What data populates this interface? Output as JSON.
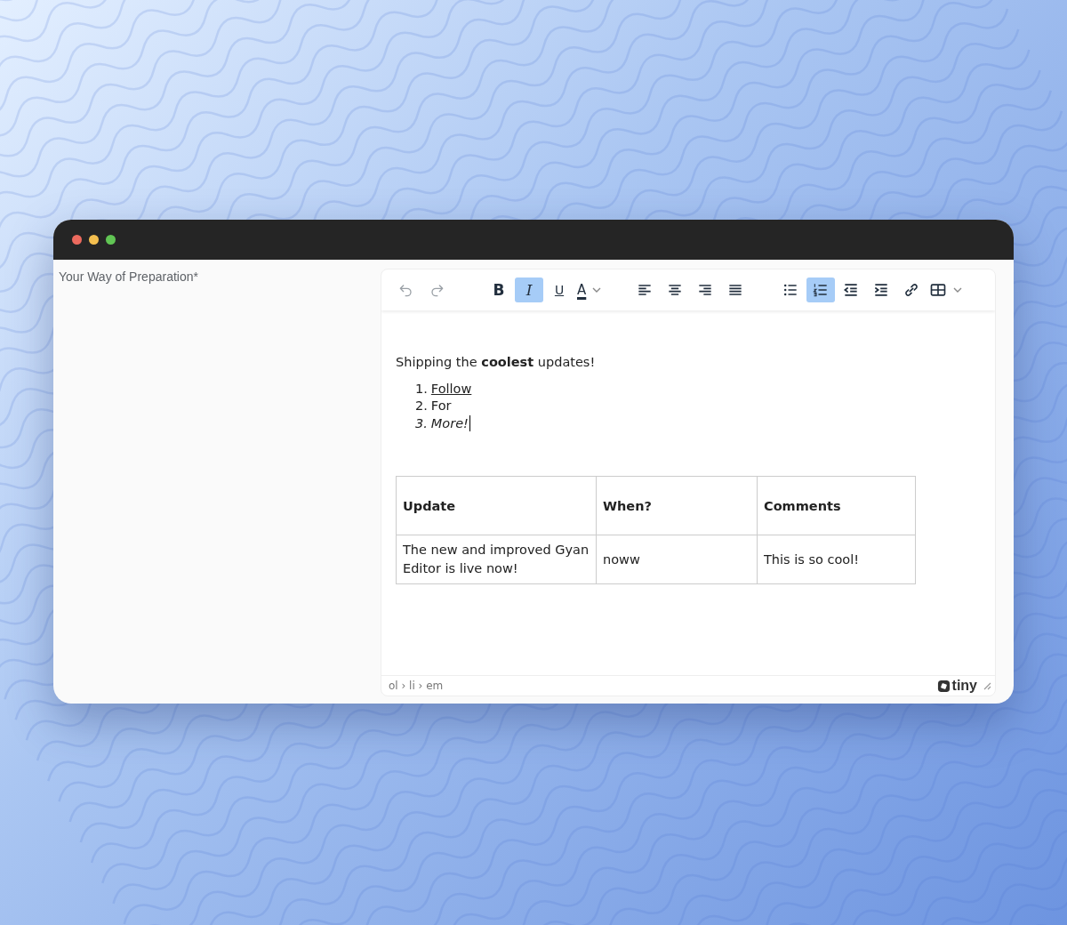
{
  "form": {
    "label": "Your Way of Preparation*"
  },
  "toolbar": [
    [
      {
        "kind": "undo",
        "selected": false,
        "disabled": true
      },
      {
        "kind": "redo",
        "selected": false,
        "disabled": true
      }
    ],
    [
      {
        "kind": "bold",
        "label": "B",
        "selected": false,
        "disabled": false
      },
      {
        "kind": "italic",
        "label": "I",
        "selected": true,
        "disabled": false
      },
      {
        "kind": "underline",
        "label": "U",
        "selected": false,
        "disabled": false
      },
      {
        "kind": "forecolor",
        "label": "A",
        "selected": false,
        "disabled": false
      }
    ],
    [
      {
        "kind": "align-left",
        "selected": false,
        "disabled": false
      },
      {
        "kind": "align-center",
        "selected": false,
        "disabled": false
      },
      {
        "kind": "align-right",
        "selected": false,
        "disabled": false
      },
      {
        "kind": "justify",
        "selected": false,
        "disabled": false
      }
    ],
    [
      {
        "kind": "bullist",
        "selected": false,
        "disabled": false
      },
      {
        "kind": "numlist",
        "selected": true,
        "disabled": false
      },
      {
        "kind": "outdent",
        "selected": false,
        "disabled": false
      },
      {
        "kind": "indent",
        "selected": false,
        "disabled": false
      },
      {
        "kind": "link",
        "selected": false,
        "disabled": false
      },
      {
        "kind": "table",
        "selected": false,
        "disabled": false
      }
    ]
  ],
  "content": {
    "paragraph": "Shipping the **coolest** updates!",
    "list": [
      {
        "number": "1.",
        "text": "Follow",
        "kind": "underline",
        "cursor": false
      },
      {
        "number": "2.",
        "text": "For",
        "kind": "plain",
        "cursor": false
      },
      {
        "number": "3.",
        "text": "More!",
        "kind": "italic",
        "cursor": true
      }
    ],
    "table": {
      "columns": [
        "Update",
        "When?",
        "Comments"
      ],
      "rows": [
        [
          "The new and improved Gyan Editor is live now!",
          "noww",
          "This is so cool!"
        ]
      ]
    }
  },
  "status_bar": {
    "path": "ol › li › em",
    "brand": "tiny"
  }
}
